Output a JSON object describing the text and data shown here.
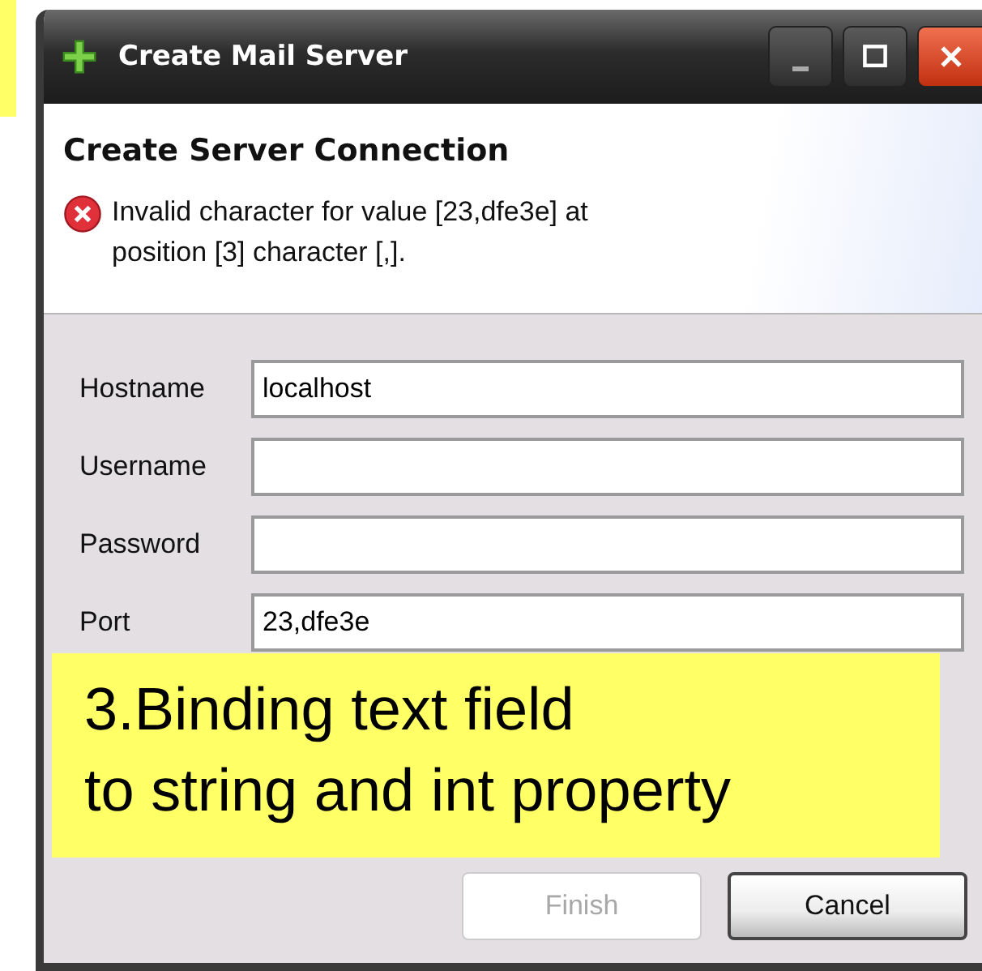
{
  "window": {
    "title": "Create Mail Server"
  },
  "header": {
    "title": "Create Server Connection",
    "error": {
      "message": "Invalid character for value [23,dfe3e] at position [3] character [,]."
    }
  },
  "fields": [
    {
      "label": "Hostname",
      "value": "localhost"
    },
    {
      "label": "Username"
    },
    {
      "label": "Password"
    },
    {
      "label": "Port",
      "value": "23,dfe3e"
    }
  ],
  "buttons": [
    {
      "label": "Finish",
      "disabled": true
    },
    {
      "label": "Cancel",
      "disabled": false
    }
  ],
  "annotation": {
    "lines": [
      "3.Binding text field",
      "to string and int property"
    ]
  }
}
